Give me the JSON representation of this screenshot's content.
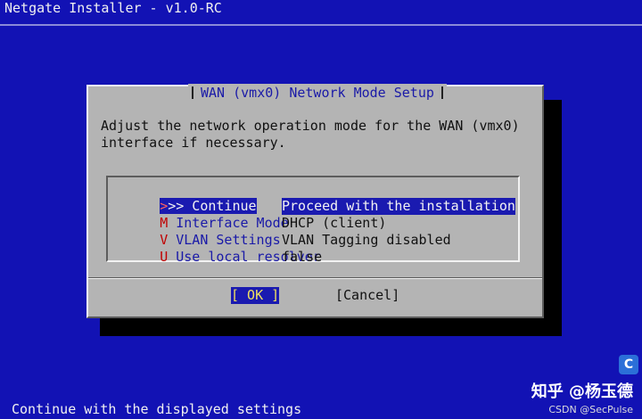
{
  "window": {
    "title": "Netgate Installer - v1.0-RC"
  },
  "dialog": {
    "title": "WAN (vmx0) Network Mode Setup",
    "prompt_line1": "Adjust the network operation mode for the WAN (vmx0)",
    "prompt_line2": "interface if necessary.",
    "menu": [
      {
        "hotkey": ">",
        "name": ">> Continue",
        "value": "Proceed with the installation",
        "selected": true
      },
      {
        "hotkey": "M",
        "name": " Interface Mode",
        "value": "DHCP (client)",
        "selected": false
      },
      {
        "hotkey": "V",
        "name": " VLAN Settings",
        "value": "VLAN Tagging disabled",
        "selected": false
      },
      {
        "hotkey": "U",
        "name": " Use local resolver",
        "value": "false",
        "selected": false
      }
    ],
    "buttons": {
      "ok_label": "[ OK ]",
      "cancel_label": "[Cancel]"
    }
  },
  "status_bar": {
    "text": "Continue with the displayed settings"
  },
  "watermark": {
    "line1": "知乎 @杨玉德",
    "line2": "CSDN @SecPulse"
  },
  "colors": {
    "background": "#1212b4",
    "dialog": "#b4b4b4",
    "highlight": "#1a1ab0",
    "hotkey": "#c00000"
  }
}
